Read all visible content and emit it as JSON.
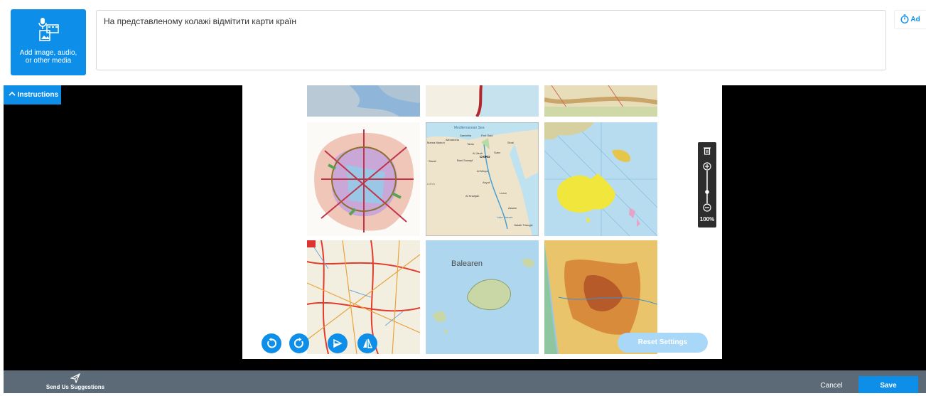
{
  "media": {
    "label_line1": "Add image, audio,",
    "label_line2": "or other media"
  },
  "question": {
    "text": "На представленому колажі відмітити карти країн"
  },
  "top_right": {
    "label": "Ad"
  },
  "instructions": {
    "label": "Instructions"
  },
  "zoom": {
    "level": "100%"
  },
  "maps": {
    "egypt_sea": "Mediterranean Sea",
    "egypt_cities": [
      "Damietta",
      "Port Said",
      "Alexandria",
      "Tanta",
      "Marsa Matruh",
      "Al Jizah",
      "CAIRO",
      "Suez",
      "Siwah",
      "Bani Suwayf",
      "Al Minya",
      "Asyut",
      "Al Kharijah",
      "Luxor",
      "Aswan",
      "Lake Nasser",
      "Halaib Triangle",
      "LIBYA",
      "Sinai"
    ],
    "baleares": "Balearen"
  },
  "canvas_controls": {
    "reset_label": "Reset Settings"
  },
  "footer": {
    "suggest_label": "Send Us Suggestions",
    "cancel_label": "Cancel",
    "save_label": "Save"
  },
  "colors": {
    "accent": "#0d8ee9",
    "footer": "#5c6a77",
    "stage": "#000000"
  }
}
